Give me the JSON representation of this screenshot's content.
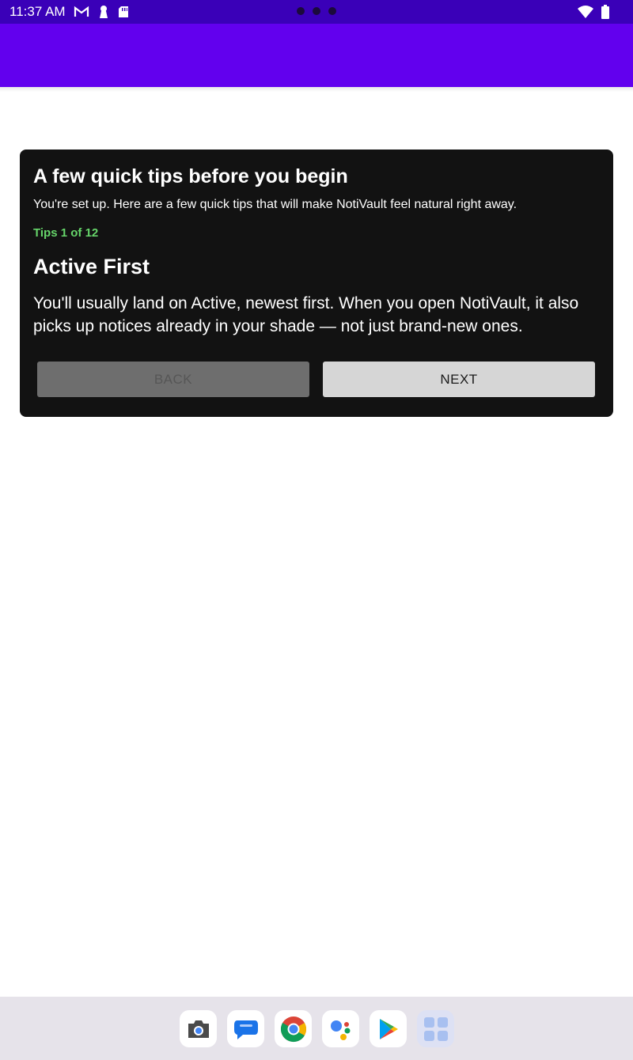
{
  "status_bar": {
    "time": "11:37 AM",
    "left_icons": [
      "gmail-icon",
      "keyhole-icon",
      "sd-card-icon"
    ],
    "right_icons": [
      "wifi-icon",
      "battery-icon"
    ]
  },
  "colors": {
    "status_bar": "#3a00b8",
    "app_bar": "#6200ee",
    "card_background": "#121212",
    "tip_counter": "#66d56a",
    "back_button": "#6e6e6e",
    "next_button": "#d6d6d6"
  },
  "tips_card": {
    "title": "A few quick tips before you begin",
    "subtitle": "You're set up. Here are a few quick tips that will make NotiVault feel natural right away.",
    "counter": "Tips 1 of 12",
    "tip_title": "Active First",
    "tip_body": "You'll usually land on Active, newest first. When you open NotiVault, it also picks up notices already in your shade — not just brand-new ones.",
    "back_label": "BACK",
    "next_label": "NEXT"
  },
  "dock": {
    "apps": [
      "camera-icon",
      "messages-icon",
      "chrome-icon",
      "assistant-icon",
      "play-store-icon",
      "all-apps-icon"
    ]
  }
}
